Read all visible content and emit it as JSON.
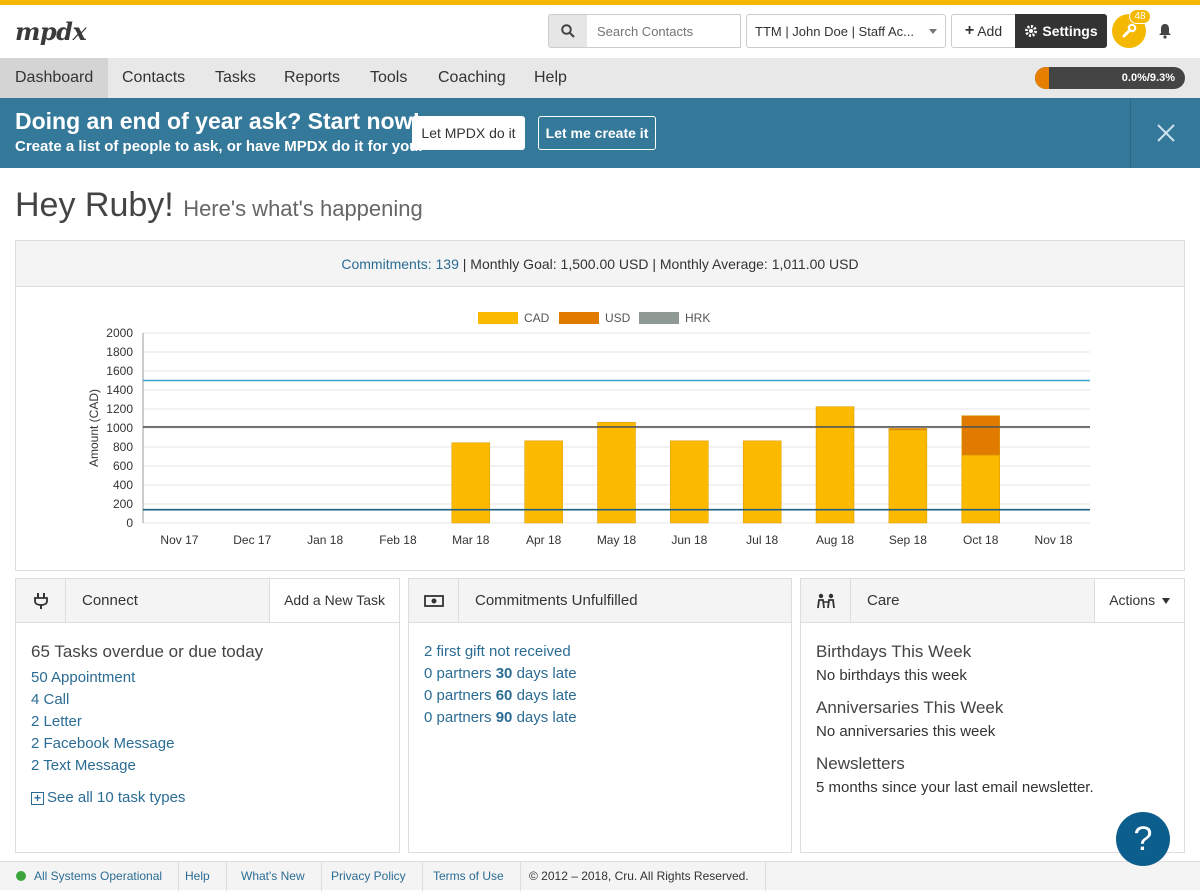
{
  "header": {
    "logo": "mpdx",
    "search_placeholder": "Search Contacts",
    "account": "TTM | John Doe | Staff Ac...",
    "add_label": "Add",
    "settings_label": "Settings",
    "notification_count": "48"
  },
  "nav": {
    "items": [
      "Dashboard",
      "Contacts",
      "Tasks",
      "Reports",
      "Tools",
      "Coaching",
      "Help"
    ],
    "active": "Dashboard",
    "progress_text": "0.0%/9.3%",
    "progress_fraction": 0.093
  },
  "banner": {
    "title": "Doing an end of year ask? Start now!",
    "subtitle": "Create a list of people to ask, or have MPDX do it for you.",
    "btn_auto": "Let MPDX do it",
    "btn_manual": "Let me create it"
  },
  "greeting": {
    "title": "Hey Ruby!",
    "subtitle": "Here's what's happening"
  },
  "summary": {
    "commitments": "Commitments: 139",
    "goal": " | Monthly Goal: 1,500.00 USD | Monthly Average: 1,011.00 USD"
  },
  "chart_data": {
    "type": "bar",
    "stacked": true,
    "categories": [
      "Nov 17",
      "Dec 17",
      "Jan 18",
      "Feb 18",
      "Mar 18",
      "Apr 18",
      "May 18",
      "Jun 18",
      "Jul 18",
      "Aug 18",
      "Sep 18",
      "Oct 18",
      "Nov 18"
    ],
    "series": [
      {
        "name": "CAD",
        "color": "#fbb900",
        "values": [
          0,
          0,
          0,
          0,
          845,
          865,
          1060,
          865,
          865,
          1225,
          980,
          715,
          0
        ]
      },
      {
        "name": "USD",
        "color": "#e07b00",
        "values": [
          0,
          0,
          0,
          0,
          0,
          0,
          0,
          0,
          0,
          0,
          15,
          415,
          0
        ]
      },
      {
        "name": "HRK",
        "color": "#8f9a95",
        "values": [
          0,
          0,
          0,
          0,
          0,
          0,
          0,
          0,
          0,
          0,
          0,
          0,
          0
        ]
      }
    ],
    "reference_lines": [
      {
        "value": 1500,
        "color": "#3aa6d2"
      },
      {
        "value": 1011,
        "color": "#555555"
      },
      {
        "value": 140,
        "color": "#1e5f82"
      }
    ],
    "ylabel": "Amount (CAD)",
    "ylim": [
      0,
      2000
    ],
    "yticks": [
      0,
      200,
      400,
      600,
      800,
      1000,
      1200,
      1400,
      1600,
      1800,
      2000
    ],
    "grid": true,
    "legend": "top-center"
  },
  "connect": {
    "title": "Connect",
    "action": "Add a New Task",
    "overdue": "65 Tasks overdue or due today",
    "tasks": [
      "50 Appointment",
      "4 Call",
      "2 Letter",
      "2 Facebook Message",
      "2 Text Message"
    ],
    "see_all": "See all 10 task types"
  },
  "commitments_panel": {
    "title": "Commitments Unfulfilled",
    "first_gift": "2 first gift not received",
    "late": [
      {
        "prefix": "0 partners ",
        "days": "30",
        "suffix": " days late"
      },
      {
        "prefix": "0 partners ",
        "days": "60",
        "suffix": " days late"
      },
      {
        "prefix": "0 partners ",
        "days": "90",
        "suffix": " days late"
      }
    ]
  },
  "care": {
    "title": "Care",
    "action": "Actions",
    "birthdays_head": "Birthdays This Week",
    "birthdays_text": "No birthdays this week",
    "anniv_head": "Anniversaries This Week",
    "anniv_text": "No anniversaries this week",
    "news_head": "Newsletters",
    "news_text": "5 months since your last email newsletter."
  },
  "footer": {
    "status": "All Systems Operational",
    "help": "Help",
    "whats_new": "What's New",
    "privacy": "Privacy Policy",
    "terms": "Terms of Use",
    "copyright": "© 2012 – 2018, Cru. All Rights Reserved."
  },
  "help_bubble": "?"
}
